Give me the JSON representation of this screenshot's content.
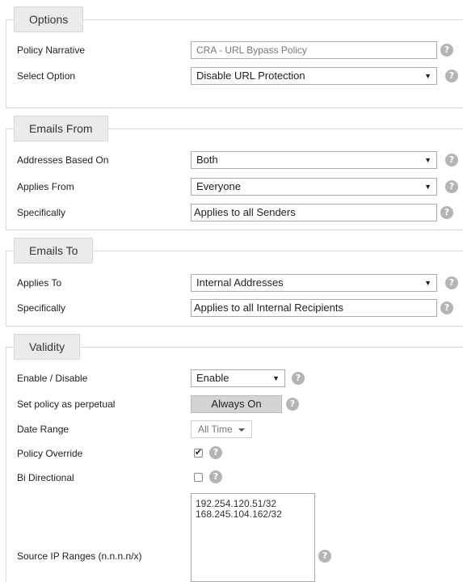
{
  "sections": {
    "options": {
      "title": "Options",
      "policy_narrative": {
        "label": "Policy Narrative",
        "value": "CRA - URL Bypass Policy"
      },
      "select_option": {
        "label": "Select Option",
        "value": "Disable URL Protection"
      }
    },
    "emails_from": {
      "title": "Emails From",
      "addresses_based_on": {
        "label": "Addresses Based On",
        "value": "Both"
      },
      "applies_from": {
        "label": "Applies From",
        "value": "Everyone"
      },
      "specifically": {
        "label": "Specifically",
        "value": "Applies to all Senders"
      }
    },
    "emails_to": {
      "title": "Emails To",
      "applies_to": {
        "label": "Applies To",
        "value": "Internal Addresses"
      },
      "specifically": {
        "label": "Specifically",
        "value": "Applies to all Internal Recipients"
      }
    },
    "validity": {
      "title": "Validity",
      "enable_disable": {
        "label": "Enable / Disable",
        "value": "Enable"
      },
      "perpetual": {
        "label": "Set policy as perpetual",
        "button": "Always On"
      },
      "date_range": {
        "label": "Date Range",
        "value": "All Time"
      },
      "policy_override": {
        "label": "Policy Override",
        "checked": true
      },
      "bi_directional": {
        "label": "Bi Directional",
        "checked": false
      },
      "source_ip": {
        "label": "Source IP Ranges (n.n.n.n/x)",
        "lines": [
          "192.254.120.51/32",
          "168.245.104.162/32"
        ]
      }
    }
  },
  "icons": {
    "help": "?",
    "select_arrow": "▼"
  }
}
